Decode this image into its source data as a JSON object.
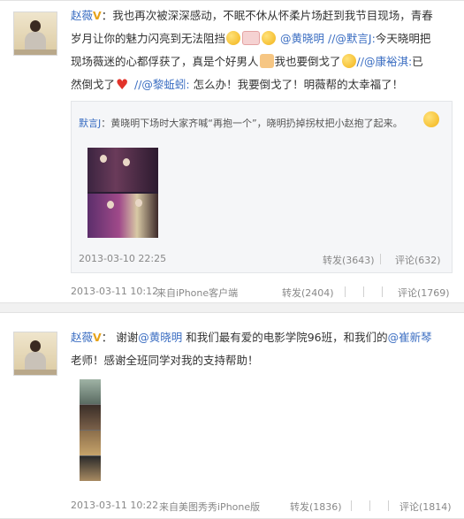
{
  "post1": {
    "username": "赵薇",
    "badge": "V",
    "colon": "：",
    "segments": [
      {
        "t": "text",
        "v": "我也再次被深深感动，不眠不休从怀柔片场赶到我节目现场，青春"
      },
      {
        "t": "text",
        "v": "岁月让你的魅力闪亮到无法阻挡"
      },
      {
        "t": "mention",
        "v": "@黄晓明"
      },
      {
        "t": "mention",
        "v": "//@默言J:"
      },
      {
        "t": "text",
        "v": "今天晓明把"
      },
      {
        "t": "text",
        "v": "现场薇迷的心都俘获了，真是个好男人"
      },
      {
        "t": "text",
        "v": "我也要倒戈了"
      },
      {
        "t": "mention",
        "v": "//@康裕淇:"
      },
      {
        "t": "text",
        "v": "已"
      },
      {
        "t": "text",
        "v": "然倒戈了"
      },
      {
        "t": "mention",
        "v": "//@黎蚯蚓:"
      },
      {
        "t": "text",
        "v": "怎么办！我要倒戈了！明薇帮的太幸福了！"
      }
    ],
    "quote": {
      "author": "默言J",
      "text": "：黄晓明下场时大家齐喊“再抱一个”，晓明扔掉拐杖把小赵抱了起来。",
      "date": "2013-03-10 22:25",
      "repost": "转发(3643)",
      "comment": "评论(632)"
    },
    "date": "2013-03-11 10:12",
    "source": "来自iPhone客户端",
    "repost": "转发(2404)",
    "comment": "评论(1769)"
  },
  "post2": {
    "username": "赵薇",
    "badge": "V",
    "colon": "：",
    "line1_a": "谢谢",
    "mention1": "@黄晓明",
    "line1_b": "和我们最有爱的电影学院96班，和我们的",
    "mention2": "@崔新琴",
    "line2": "老师！感谢全班同学对我的支持帮助！",
    "date": "2013-03-11 10:22",
    "source": "来自美图秀秀iPhone版",
    "repost": "转发(1836)",
    "comment": "评论(1814)"
  },
  "colors": {
    "link": "#3b6ec2",
    "badge": "#e6a31a",
    "meta": "#888888",
    "quote_bg": "#f5f6f8"
  }
}
